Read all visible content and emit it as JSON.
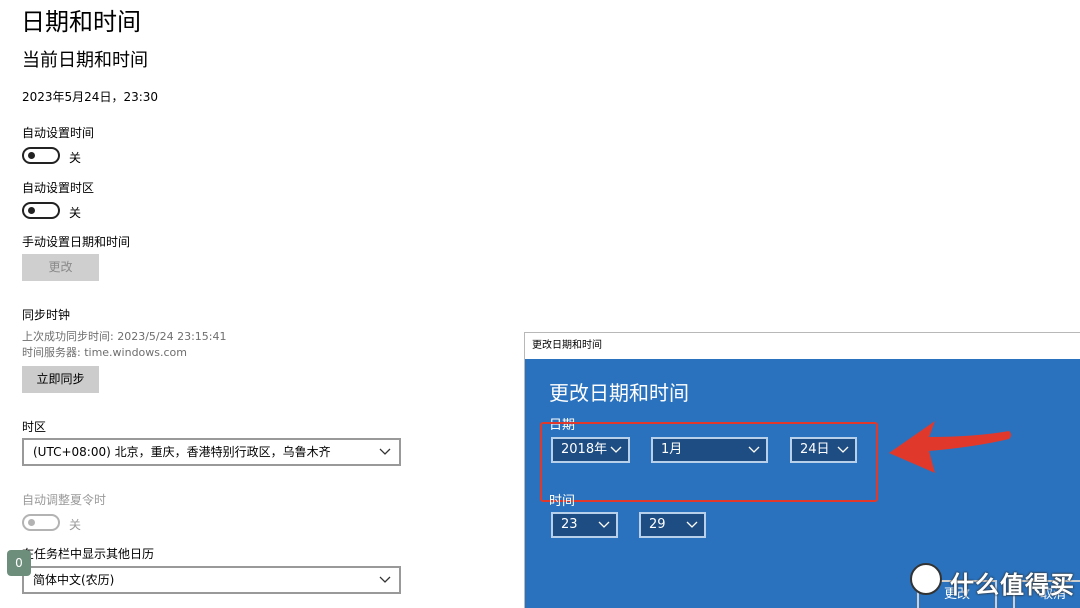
{
  "page": {
    "title": "日期和时间",
    "section_title": "当前日期和时间",
    "current_datetime": "2023年5月24日，23:30"
  },
  "auto_time": {
    "label": "自动设置时间",
    "state_text": "关",
    "on": false
  },
  "auto_timezone": {
    "label": "自动设置时区",
    "state_text": "关",
    "on": false
  },
  "manual": {
    "label": "手动设置日期和时间",
    "button": "更改"
  },
  "sync": {
    "title": "同步时钟",
    "last_sync": "上次成功同步时间: 2023/5/24 23:15:41",
    "server": "时间服务器: time.windows.com",
    "button": "立即同步"
  },
  "timezone": {
    "label": "时区",
    "value": "(UTC+08:00) 北京，重庆，香港特别行政区，乌鲁木齐"
  },
  "dst": {
    "label": "自动调整夏令时",
    "state_text": "关",
    "on": false
  },
  "calendar": {
    "label": "在任务栏中显示其他日历",
    "value": "简体中文(农历)"
  },
  "badge": {
    "count": "0"
  },
  "dialog": {
    "window_title": "更改日期和时间",
    "heading": "更改日期和时间",
    "date_label": "日期",
    "year": "2018年",
    "month": "1月",
    "day": "24日",
    "time_label": "时间",
    "hour": "23",
    "minute": "29",
    "confirm": "更改",
    "cancel": "取消"
  },
  "watermark": {
    "text": "什么值得买"
  },
  "colors": {
    "dialog_bg": "#2a72be",
    "highlight": "#e0392b",
    "dropdown_bg": "#1e4d83"
  }
}
